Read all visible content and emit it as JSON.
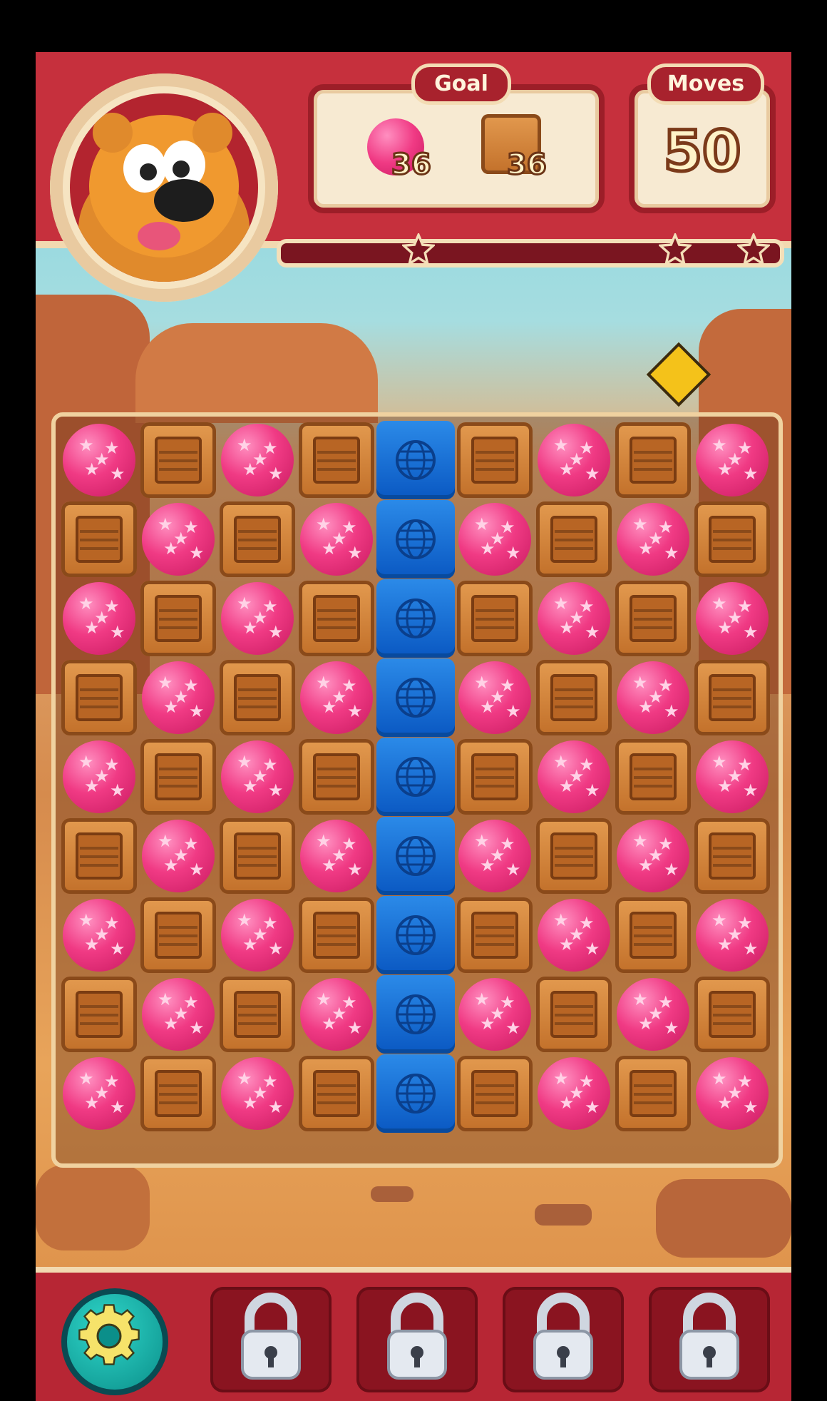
{
  "header": {
    "goal_label": "Goal",
    "moves_label": "Moves",
    "moves_value": "50",
    "goals": [
      {
        "item": "balloon-icon",
        "count": "36"
      },
      {
        "item": "crate-icon",
        "count": "36"
      }
    ],
    "progress_fraction": 0.0
  },
  "board": {
    "rows": 9,
    "cols": 9,
    "grid": [
      [
        "balloon",
        "crate",
        "balloon",
        "crate",
        "cube",
        "crate",
        "balloon",
        "crate",
        "balloon"
      ],
      [
        "crate",
        "balloon",
        "crate",
        "balloon",
        "cube",
        "balloon",
        "crate",
        "balloon",
        "crate"
      ],
      [
        "balloon",
        "crate",
        "balloon",
        "crate",
        "cube",
        "crate",
        "balloon",
        "crate",
        "balloon"
      ],
      [
        "crate",
        "balloon",
        "crate",
        "balloon",
        "cube",
        "balloon",
        "crate",
        "balloon",
        "crate"
      ],
      [
        "balloon",
        "crate",
        "balloon",
        "crate",
        "cube",
        "crate",
        "balloon",
        "crate",
        "balloon"
      ],
      [
        "crate",
        "balloon",
        "crate",
        "balloon",
        "cube",
        "balloon",
        "crate",
        "balloon",
        "crate"
      ],
      [
        "balloon",
        "crate",
        "balloon",
        "crate",
        "cube",
        "crate",
        "balloon",
        "crate",
        "balloon"
      ],
      [
        "crate",
        "balloon",
        "crate",
        "balloon",
        "cube",
        "balloon",
        "crate",
        "balloon",
        "crate"
      ],
      [
        "balloon",
        "crate",
        "balloon",
        "crate",
        "cube",
        "crate",
        "balloon",
        "crate",
        "balloon"
      ]
    ]
  },
  "bottom_bar": {
    "settings_icon": "gear-icon",
    "booster_slots": [
      {
        "state": "locked",
        "icon": "lock-icon"
      },
      {
        "state": "locked",
        "icon": "lock-icon"
      },
      {
        "state": "locked",
        "icon": "lock-icon"
      },
      {
        "state": "locked",
        "icon": "lock-icon"
      }
    ]
  },
  "colors": {
    "header_red": "#c6303d",
    "balloon_pink": "#f03a84",
    "crate_brown": "#c2702a",
    "cube_blue": "#0a58c2",
    "settings_teal": "#0b8f8a"
  }
}
